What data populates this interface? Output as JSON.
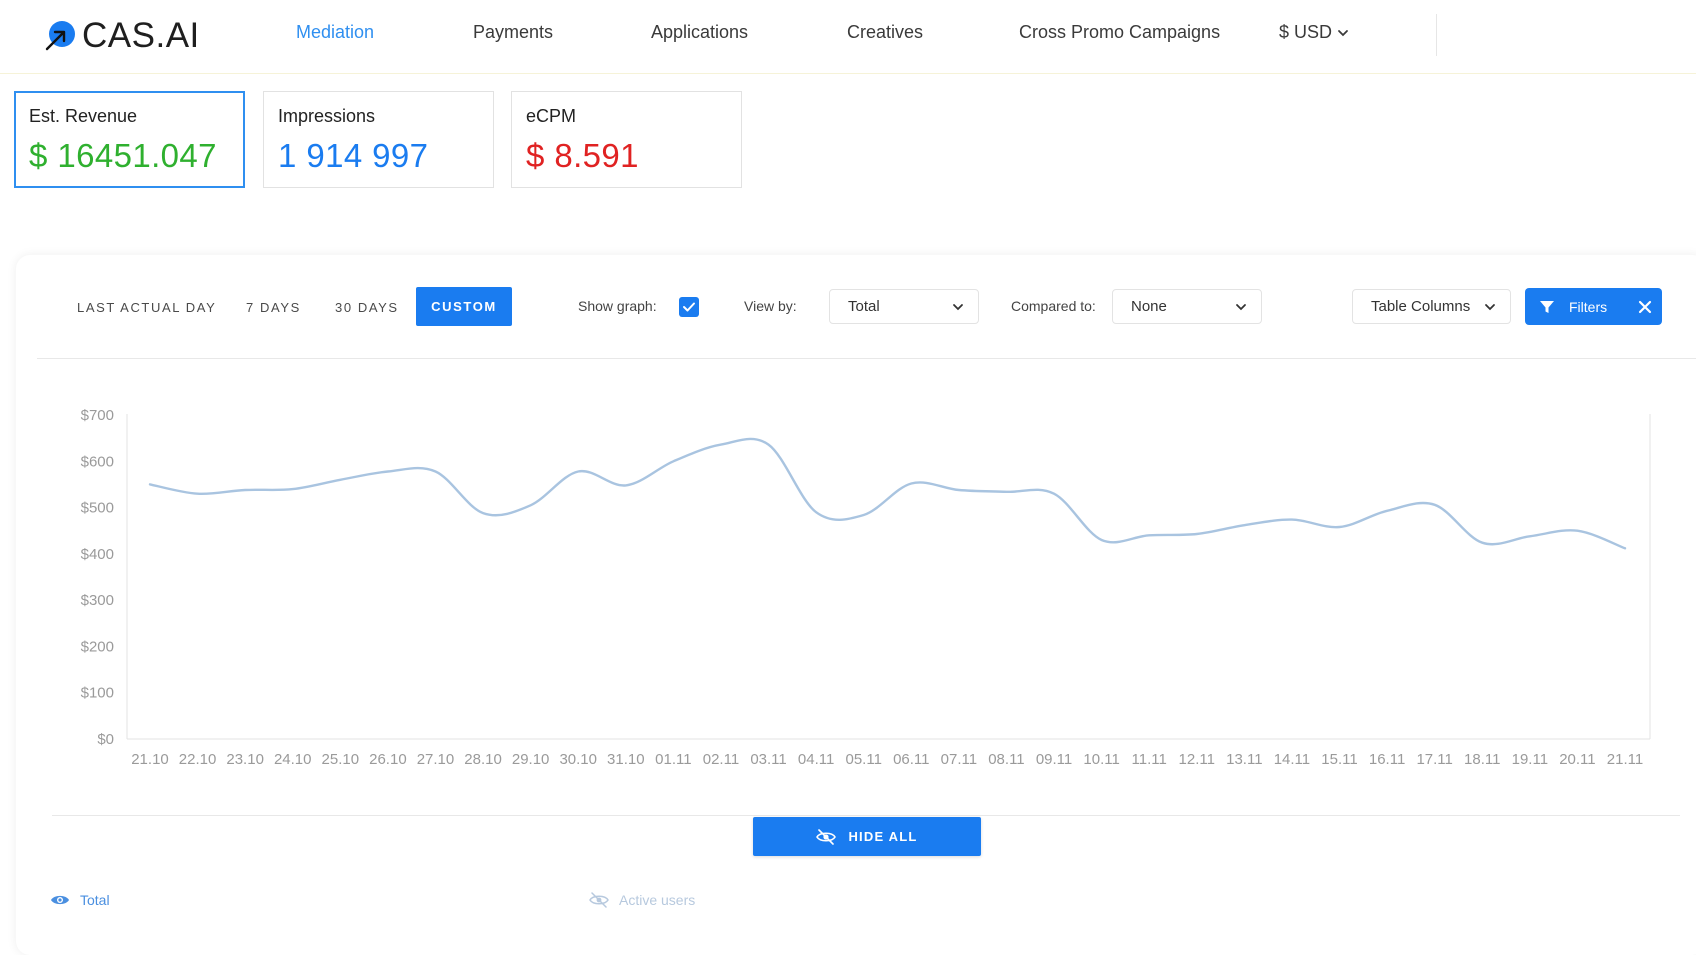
{
  "brand": {
    "name": "CAS.AI"
  },
  "nav": {
    "items": [
      {
        "label": "Mediation",
        "active": true
      },
      {
        "label": "Payments",
        "active": false
      },
      {
        "label": "Applications",
        "active": false
      },
      {
        "label": "Creatives",
        "active": false
      },
      {
        "label": "Cross Promo Campaigns",
        "active": false
      }
    ],
    "currency": "$ USD"
  },
  "kpis": [
    {
      "label": "Est. Revenue",
      "value": "$ 16451.047",
      "color": "#2fb02f",
      "selected": true
    },
    {
      "label": "Impressions",
      "value": "1 914 997",
      "color": "#1a7cf0",
      "selected": false
    },
    {
      "label": "eCPM",
      "value": "$ 8.591",
      "color": "#e02222",
      "selected": false
    }
  ],
  "controls": {
    "periods": [
      "LAST ACTUAL DAY",
      "7 DAYS",
      "30 DAYS"
    ],
    "active_period": "CUSTOM",
    "show_graph_label": "Show graph:",
    "show_graph": true,
    "view_by_label": "View by:",
    "view_by_value": "Total",
    "compared_to_label": "Compared to:",
    "compared_to_value": "None",
    "table_columns_label": "Table Columns",
    "filters_label": "Filters"
  },
  "chart_data": {
    "type": "line",
    "x": [
      "21.10",
      "22.10",
      "23.10",
      "24.10",
      "25.10",
      "26.10",
      "27.10",
      "28.10",
      "29.10",
      "30.10",
      "31.10",
      "01.11",
      "02.11",
      "03.11",
      "04.11",
      "05.11",
      "06.11",
      "07.11",
      "08.11",
      "09.11",
      "10.11",
      "11.11",
      "12.11",
      "13.11",
      "14.11",
      "15.11",
      "16.11",
      "17.11",
      "18.11",
      "19.11",
      "20.11",
      "21.11"
    ],
    "series": [
      {
        "name": "Total",
        "values": [
          550,
          530,
          538,
          540,
          560,
          578,
          578,
          488,
          505,
          578,
          548,
          600,
          636,
          636,
          490,
          484,
          552,
          538,
          534,
          530,
          430,
          440,
          443,
          462,
          474,
          458,
          493,
          506,
          424,
          438,
          450,
          412
        ]
      }
    ],
    "yticks": [
      "$700",
      "$600",
      "$500",
      "$400",
      "$300",
      "$200",
      "$100",
      "$0"
    ],
    "ylim": [
      0,
      700
    ],
    "line_color": "#a9c4e0",
    "grid": false
  },
  "bottom": {
    "hide_all_label": "HIDE ALL",
    "legend": [
      {
        "label": "Total",
        "visible": true,
        "icon": "eye-icon"
      },
      {
        "label": "Active users",
        "visible": false,
        "icon": "eye-off-icon"
      }
    ]
  }
}
